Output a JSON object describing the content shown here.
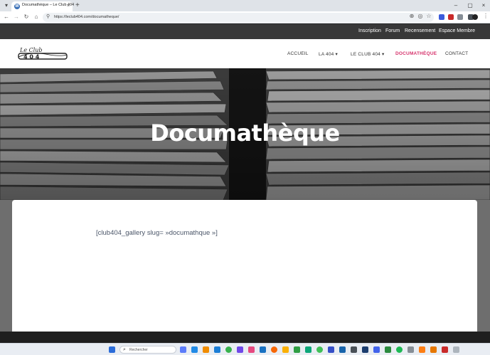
{
  "browser": {
    "tab_title": "Documathèque – Le Club 404",
    "tab_close": "×",
    "new_tab": "+",
    "url": "https://leclub404.com/documatheque/",
    "window_controls": [
      "–",
      "▢",
      "×"
    ]
  },
  "site": {
    "top_links": [
      "Inscription",
      "Forum",
      "Recensement",
      "Espace Membre"
    ],
    "logo_alt": "Le Club 404",
    "nav": [
      "ACCUEIL",
      "LA 404 ▾",
      "LE CLUB 404 ▾",
      "DOCUMATHÈQUE",
      "CONTACT"
    ],
    "active_nav": "DOCUMATHÈQUE",
    "hero_title": "Documathèque",
    "shortcode": "[club404_gallery slug= »documathque »]"
  },
  "taskbar": {
    "search_placeholder": "Rechercher"
  },
  "colors": {
    "accent": "#d6336c",
    "topbar": "#383838",
    "footer": "#1f1f1f"
  }
}
